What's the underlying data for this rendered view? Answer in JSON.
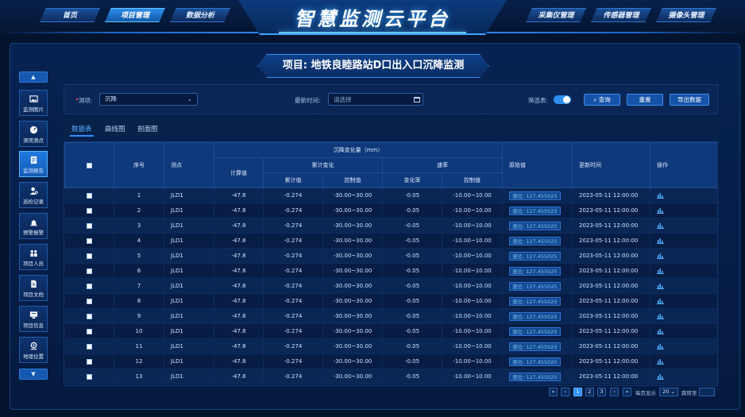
{
  "app_title": "智慧监测云平台",
  "nav_left": [
    {
      "label": "首页"
    },
    {
      "label": "项目管理"
    },
    {
      "label": "数据分析"
    }
  ],
  "nav_right": [
    {
      "label": "采集仪管理"
    },
    {
      "label": "传感器管理"
    },
    {
      "label": "摄像头管理"
    }
  ],
  "project_title": "项目: 地铁良睦路站D口出入口沉降监测",
  "sidebar": [
    {
      "label": "监测图片",
      "icon": "image-icon"
    },
    {
      "label": "测项测点",
      "icon": "gauge-icon"
    },
    {
      "label": "监测报告",
      "icon": "report-icon"
    },
    {
      "label": "巡检记录",
      "icon": "inspector-icon"
    },
    {
      "label": "预警报警",
      "icon": "alarm-icon"
    },
    {
      "label": "项目人员",
      "icon": "people-icon"
    },
    {
      "label": "项目文档",
      "icon": "document-icon"
    },
    {
      "label": "项目信息",
      "icon": "info-icon"
    },
    {
      "label": "地理位置",
      "icon": "location-icon"
    }
  ],
  "filters": {
    "item_label": "测项:",
    "item_value": "沉降",
    "time_label": "最新时间:",
    "time_placeholder": "请选择",
    "screen_label": "筛选表:",
    "query_btn": "查询",
    "reset_btn": "重置",
    "export_btn": "导出数据"
  },
  "tabs": [
    {
      "label": "数据表"
    },
    {
      "label": "曲线图"
    },
    {
      "label": "剖面图"
    }
  ],
  "table": {
    "headers": {
      "index": "序号",
      "point": "测点",
      "group": "沉降变化量（mm）",
      "calc": "计算值",
      "cumulative": "累计变化",
      "rate": "速率",
      "cum_value": "累计值",
      "cum_control": "控制值",
      "rate_value": "变化率",
      "rate_control": "控制值",
      "raw": "原始值",
      "updated": "更新时间",
      "action": "操作"
    },
    "rows": [
      {
        "index": "1",
        "point": "JLD1",
        "calc": "-47.8",
        "cum": "-0.274",
        "cum_ctrl": "-30.00~30.00",
        "rate": "-0.05",
        "rate_ctrl": "-10.00~10.00",
        "raw": "液位: 127.455025",
        "time": "2023-05-11 12:00:00"
      },
      {
        "index": "2",
        "point": "JLD1",
        "calc": "-47.8",
        "cum": "-0.274",
        "cum_ctrl": "-30.00~30.00",
        "rate": "-0.05",
        "rate_ctrl": "-10.00~10.00",
        "raw": "液位: 127.455025",
        "time": "2023-05-11 12:00:00"
      },
      {
        "index": "3",
        "point": "JLD1",
        "calc": "-47.8",
        "cum": "-0.274",
        "cum_ctrl": "-30.00~30.00",
        "rate": "-0.05",
        "rate_ctrl": "-10.00~10.00",
        "raw": "液位: 127.455025",
        "time": "2023-05-11 12:00:00"
      },
      {
        "index": "4",
        "point": "JLD1",
        "calc": "-47.8",
        "cum": "-0.274",
        "cum_ctrl": "-30.00~30.00",
        "rate": "-0.05",
        "rate_ctrl": "-10.00~10.00",
        "raw": "液位: 127.455025",
        "time": "2023-05-11 12:00:00"
      },
      {
        "index": "5",
        "point": "JLD1",
        "calc": "-47.8",
        "cum": "-0.274",
        "cum_ctrl": "-30.00~30.00",
        "rate": "-0.05",
        "rate_ctrl": "-10.00~10.00",
        "raw": "液位: 127.455025",
        "time": "2023-05-11 12:00:00"
      },
      {
        "index": "6",
        "point": "JLD1",
        "calc": "-47.8",
        "cum": "-0.274",
        "cum_ctrl": "-30.00~30.00",
        "rate": "-0.05",
        "rate_ctrl": "-10.00~10.00",
        "raw": "液位: 127.455025",
        "time": "2023-05-11 12:00:00"
      },
      {
        "index": "7",
        "point": "JLD1",
        "calc": "-47.8",
        "cum": "-0.274",
        "cum_ctrl": "-30.00~30.00",
        "rate": "-0.05",
        "rate_ctrl": "-10.00~10.00",
        "raw": "液位: 127.455025",
        "time": "2023-05-11 12:00:00"
      },
      {
        "index": "8",
        "point": "JLD1",
        "calc": "-47.8",
        "cum": "-0.274",
        "cum_ctrl": "-30.00~30.00",
        "rate": "-0.05",
        "rate_ctrl": "-10.00~10.00",
        "raw": "液位: 127.455025",
        "time": "2023-05-11 12:00:00"
      },
      {
        "index": "9",
        "point": "JLD1",
        "calc": "-47.8",
        "cum": "-0.274",
        "cum_ctrl": "-30.00~30.00",
        "rate": "-0.05",
        "rate_ctrl": "-10.00~10.00",
        "raw": "液位: 127.455025",
        "time": "2023-05-11 12:00:00"
      },
      {
        "index": "10",
        "point": "JLD1",
        "calc": "-47.8",
        "cum": "-0.274",
        "cum_ctrl": "-30.00~30.00",
        "rate": "-0.05",
        "rate_ctrl": "-10.00~10.00",
        "raw": "液位: 127.455025",
        "time": "2023-05-11 12:00:00"
      },
      {
        "index": "11",
        "point": "JLD1",
        "calc": "-47.8",
        "cum": "-0.274",
        "cum_ctrl": "-30.00~30.00",
        "rate": "-0.05",
        "rate_ctrl": "-10.00~10.00",
        "raw": "液位: 127.455025",
        "time": "2023-05-11 12:00:00"
      },
      {
        "index": "12",
        "point": "JLD1",
        "calc": "-47.8",
        "cum": "-0.274",
        "cum_ctrl": "-30.00~30.00",
        "rate": "-0.05",
        "rate_ctrl": "-10.00~10.00",
        "raw": "液位: 127.455025",
        "time": "2023-05-11 12:00:00"
      },
      {
        "index": "13",
        "point": "JLD1",
        "calc": "-47.8",
        "cum": "-0.274",
        "cum_ctrl": "-30.00~30.00",
        "rate": "-0.05",
        "rate_ctrl": "-10.00~10.00",
        "raw": "液位: 127.455025",
        "time": "2023-05-11 12:00:00"
      }
    ]
  },
  "pagination": {
    "pages": [
      "1",
      "2",
      "3"
    ],
    "page_size_label": "每页显示",
    "page_size": "20",
    "goto_label": "跳转至"
  },
  "colors": {
    "background": "#03132d",
    "accent": "#2f90ff",
    "header_row": "#0f397a"
  }
}
